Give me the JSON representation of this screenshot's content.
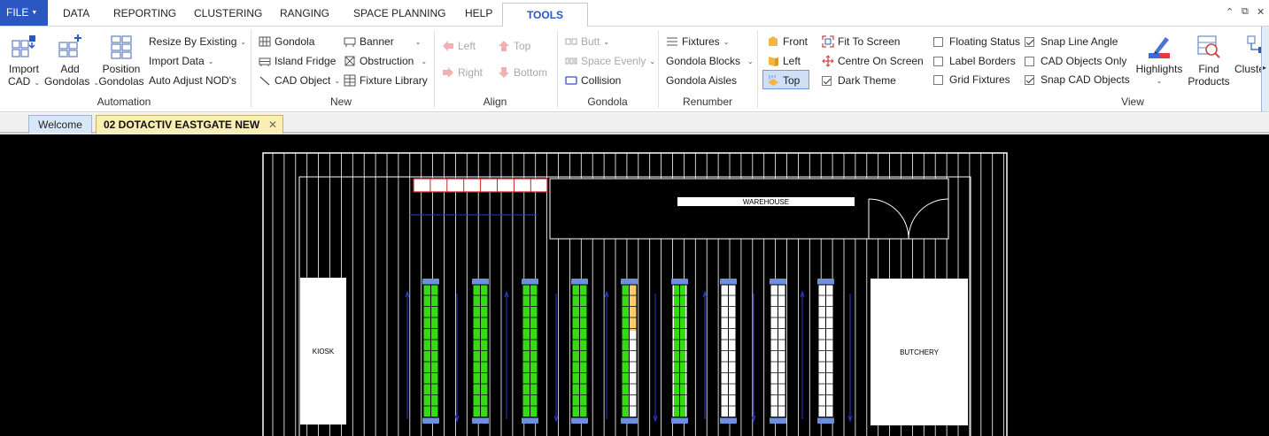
{
  "menu": {
    "file": "FILE",
    "items": [
      "DATA",
      "REPORTING",
      "CLUSTERING",
      "RANGING",
      "SPACE PLANNING",
      "HELP",
      "TOOLS"
    ],
    "active": "TOOLS"
  },
  "window": {
    "minimize": "⌃",
    "restore": "⧉",
    "close": "✕"
  },
  "ribbon": {
    "automation": {
      "label": "Automation",
      "import_cad": [
        "Import",
        "CAD"
      ],
      "add_gondolas": [
        "Add",
        "Gondolas"
      ],
      "position_gondolas": [
        "Position",
        "Gondolas"
      ],
      "resize_by_existing": "Resize By Existing",
      "import_data": "Import Data",
      "auto_adjust": "Auto Adjust NOD's"
    },
    "new": {
      "label": "New",
      "gondola": "Gondola",
      "island_fridge": "Island Fridge",
      "cad_object": "CAD Object",
      "banner": "Banner",
      "obstruction": "Obstruction",
      "fixture_library": "Fixture Library"
    },
    "align": {
      "label": "Align",
      "left": "Left",
      "right": "Right",
      "top": "Top",
      "bottom": "Bottom"
    },
    "gondola": {
      "label": "Gondola",
      "butt": "Butt",
      "space_evenly": "Space Evenly",
      "collision": "Collision"
    },
    "renumber": {
      "label": "Renumber",
      "fixtures": "Fixtures",
      "gondola_blocks": "Gondola Blocks",
      "gondola_aisles": "Gondola Aisles"
    },
    "view": {
      "label": "View",
      "front": "Front",
      "left": "Left",
      "top": "Top",
      "fit_to_screen": "Fit To Screen",
      "centre_on_screen": "Centre On Screen",
      "dark_theme": "Dark Theme",
      "floating_status": "Floating Status",
      "label_borders": "Label Borders",
      "grid_fixtures": "Grid Fixtures",
      "snap_line_angle": "Snap Line Angle",
      "cad_objects_only": "CAD Objects Only",
      "snap_cad_objects": "Snap CAD Objects",
      "highlights": "Highlights",
      "find_products": [
        "Find",
        "Products"
      ],
      "cluster": "Cluste"
    }
  },
  "checkboxes": {
    "dark_theme": true,
    "floating_status": false,
    "label_borders": false,
    "grid_fixtures": false,
    "snap_line_angle": true,
    "cad_objects_only": false,
    "snap_cad_objects": true
  },
  "tabs": {
    "welcome": "Welcome",
    "current": "02 DOTACTIV EASTGATE NEW",
    "close": "✕"
  },
  "floorplan": {
    "warehouse": "WAREHOUSE",
    "kiosk": "KIOSK",
    "butchery": "BUTCHERY"
  },
  "colors": {
    "file_blue": "#2b57c3",
    "gondola_green": "#33dd11",
    "gondola_white": "#ffffff",
    "highlight_orange": "#ffcc66",
    "endcap_blue": "#6d8fe0",
    "aisle_arrow": "#2d3cd6"
  }
}
